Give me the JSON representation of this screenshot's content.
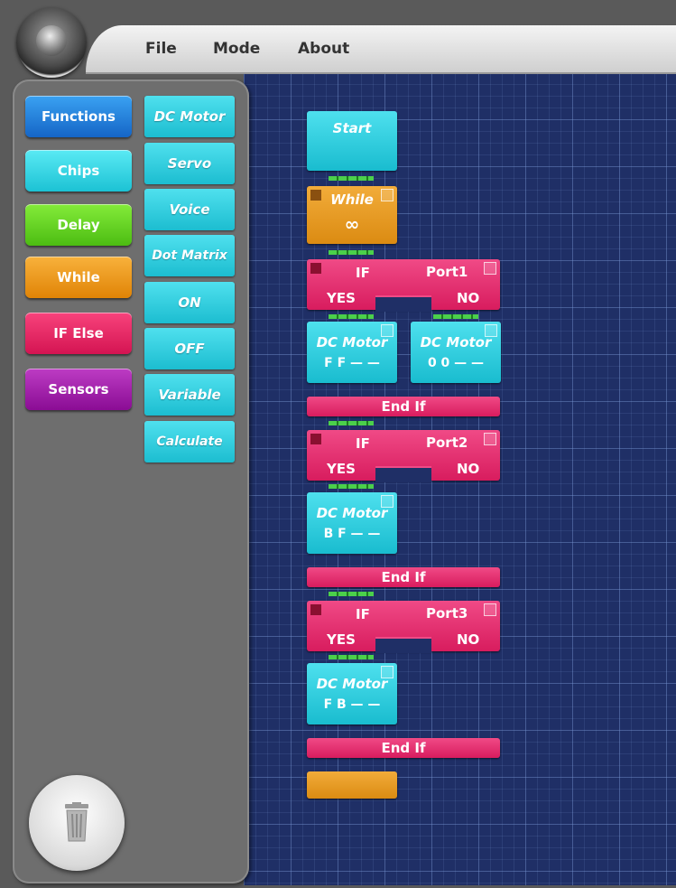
{
  "menu": {
    "file": "File",
    "mode": "Mode",
    "about": "About"
  },
  "categories": [
    "Functions",
    "Chips",
    "Delay",
    "While",
    "IF Else",
    "Sensors"
  ],
  "blocks": [
    "DC Motor",
    "Servo",
    "Voice",
    "Dot Matrix",
    "ON",
    "OFF",
    "Variable",
    "Calculate"
  ],
  "program": {
    "start": "Start",
    "while": {
      "label": "While",
      "symbol": "∞"
    },
    "if1": {
      "label": "IF",
      "port": "Port1",
      "yes": "YES",
      "no": "NO"
    },
    "motor1": {
      "label": "DC Motor",
      "value": "F F — —"
    },
    "motor2": {
      "label": "DC Motor",
      "value": "0 0 — —"
    },
    "endif1": "End If",
    "if2": {
      "label": "IF",
      "port": "Port2",
      "yes": "YES",
      "no": "NO"
    },
    "motor3": {
      "label": "DC Motor",
      "value": "B F — —"
    },
    "endif2": "End If",
    "if3": {
      "label": "IF",
      "port": "Port3",
      "yes": "YES",
      "no": "NO"
    },
    "motor4": {
      "label": "DC Motor",
      "value": "F B — —"
    },
    "endif3": "End If"
  },
  "colors": {
    "functions": "#1e7fd8",
    "chips": "#2ad6e6",
    "delay": "#5fd21a",
    "while": "#f29a12",
    "ifelse": "#e8205e",
    "sensors": "#a01aa8",
    "canvas": "#1f2f66"
  },
  "icons": {
    "logo": "knob-logo-icon",
    "trash": "trash-icon"
  }
}
